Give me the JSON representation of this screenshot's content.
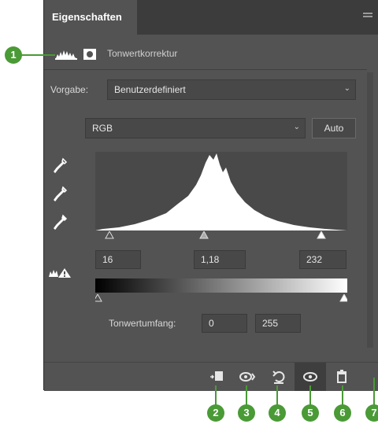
{
  "panel": {
    "tab_title": "Eigenschaften",
    "adjustment_title": "Tonwertkorrektur"
  },
  "preset": {
    "label": "Vorgabe:",
    "value": "Benutzerdefiniert"
  },
  "channel": {
    "value": "RGB",
    "auto_label": "Auto"
  },
  "input_levels": {
    "black": "16",
    "gamma": "1,18",
    "white": "232"
  },
  "output_levels": {
    "label": "Tonwertumfang:",
    "low": "0",
    "high": "255"
  },
  "icons": {
    "eyedroppers": [
      "black-point-eyedropper-icon",
      "gray-point-eyedropper-icon",
      "white-point-eyedropper-icon"
    ],
    "bottom": [
      "clip-to-layer-icon",
      "view-previous-state-icon",
      "reset-icon",
      "visibility-eye-icon",
      "delete-icon"
    ]
  },
  "callouts": [
    "1",
    "2",
    "3",
    "4",
    "5",
    "6",
    "7"
  ],
  "colors": {
    "panel": "#535353",
    "callout": "#4a9a36"
  }
}
